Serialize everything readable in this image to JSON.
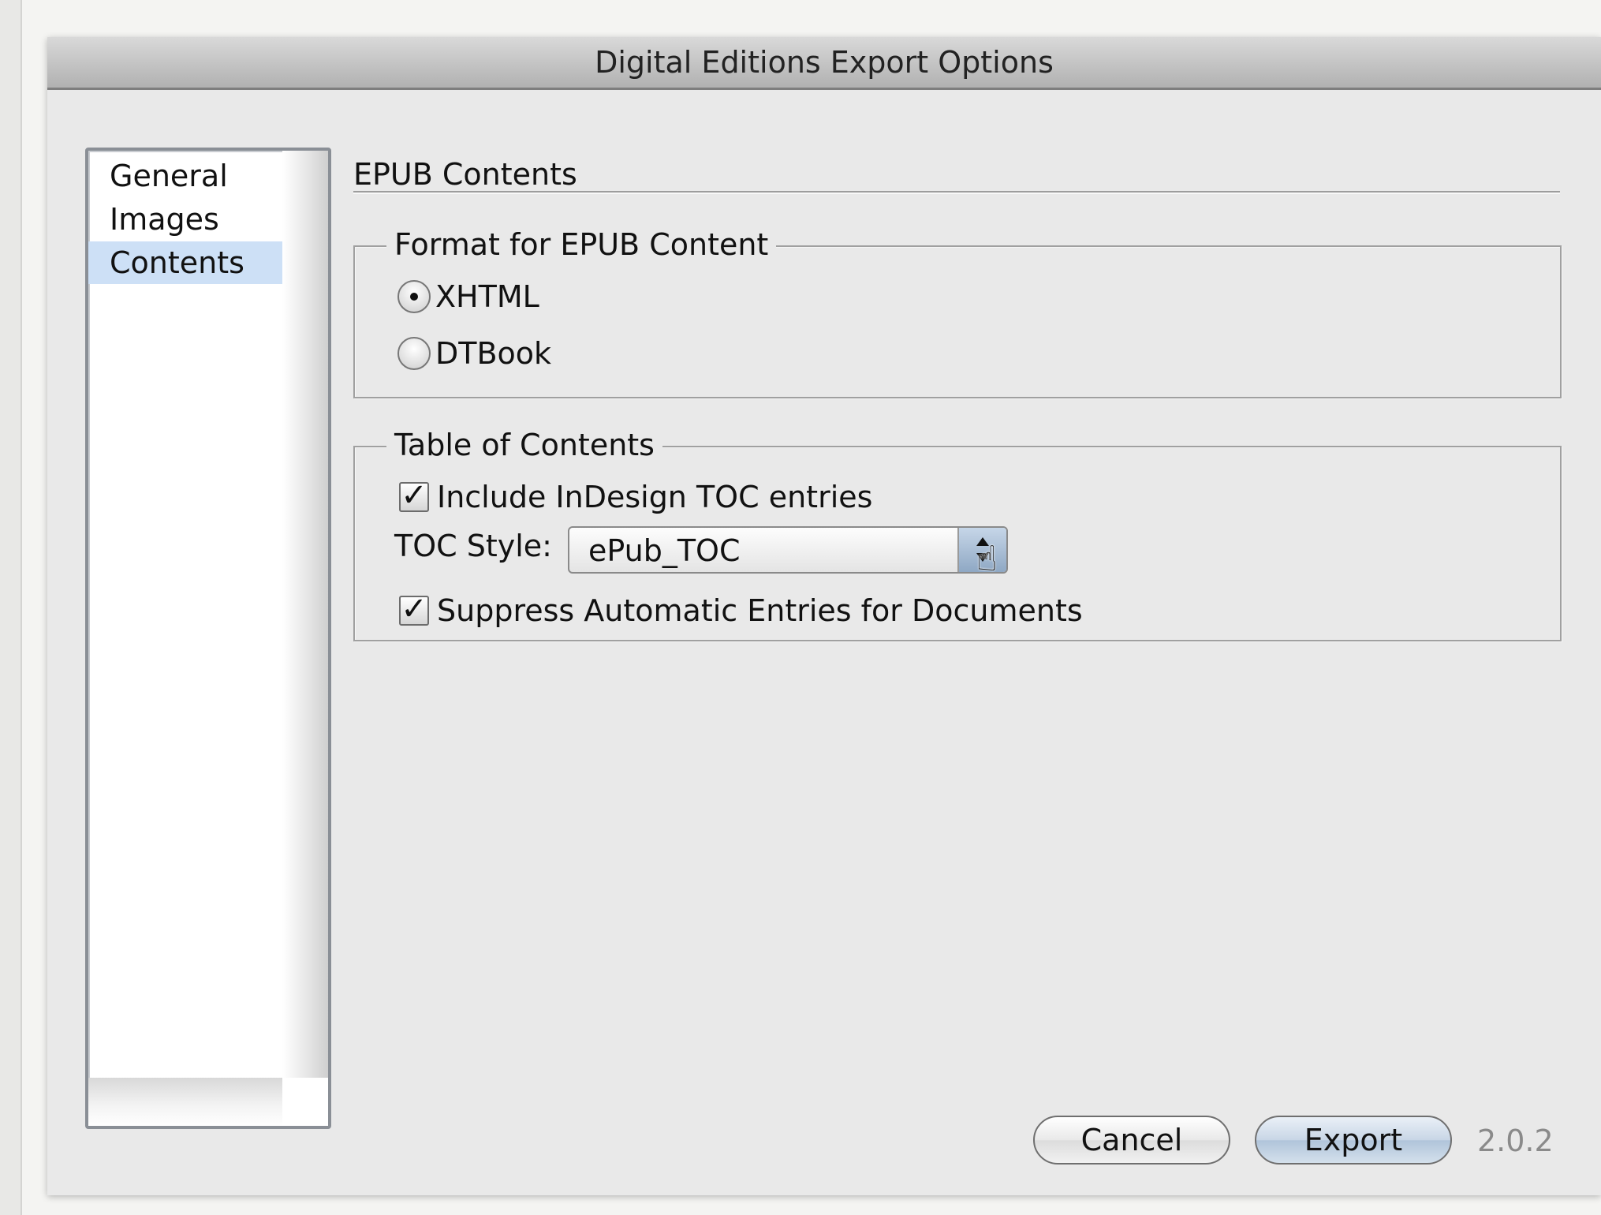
{
  "window": {
    "title": "Digital Editions Export Options"
  },
  "sidebar": {
    "items": [
      {
        "label": "General",
        "selected": false
      },
      {
        "label": "Images",
        "selected": false
      },
      {
        "label": "Contents",
        "selected": true
      }
    ]
  },
  "panel": {
    "heading": "EPUB Contents",
    "format_group": {
      "legend": "Format for EPUB Content",
      "options": [
        {
          "label": "XHTML",
          "checked": true
        },
        {
          "label": "DTBook",
          "checked": false
        }
      ]
    },
    "toc_group": {
      "legend": "Table of Contents",
      "include_toc": {
        "label": "Include InDesign TOC entries",
        "checked": true
      },
      "toc_style": {
        "label": "TOC Style:",
        "value": "ePub_TOC"
      },
      "suppress_entries": {
        "label": "Suppress Automatic Entries for Documents",
        "checked": true
      }
    }
  },
  "footer": {
    "cancel_label": "Cancel",
    "export_label": "Export",
    "version": "2.0.2"
  },
  "icons": {
    "checkmark": "check-icon",
    "pointer": "hand-pointer-icon",
    "select_arrows": "up-down-arrows-icon"
  },
  "colors": {
    "selection_highlight": "#cde0f6",
    "default_button": "#b0c4da",
    "titlebar": "#b1b1b1"
  }
}
